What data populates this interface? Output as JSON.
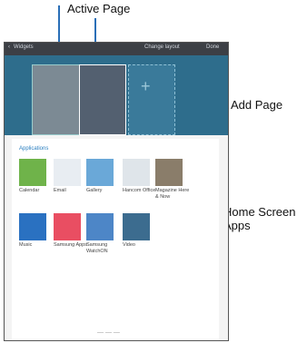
{
  "callouts": {
    "active_page": "Active Page",
    "add_page": "Add Page",
    "home_screen_apps": "Home Screen Apps"
  },
  "tablet": {
    "title": "Widgets",
    "change_layout": "Change layout",
    "done": "Done",
    "applications_label": "Applications",
    "apps_row1": [
      "Calendar",
      "Email",
      "Gallery",
      "Hancom Office",
      "Magazine Here & Now"
    ],
    "apps_row2": [
      "Music",
      "Samsung Apps",
      "Samsung WatchON",
      "Video"
    ]
  }
}
